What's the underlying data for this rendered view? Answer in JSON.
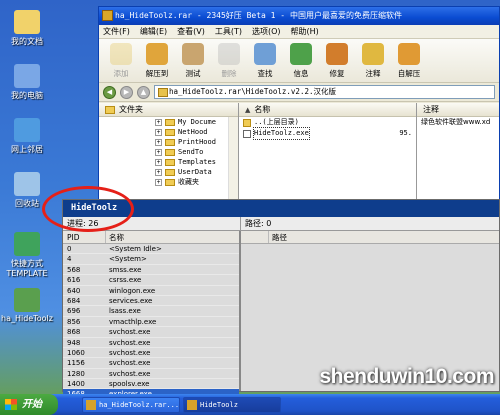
{
  "desktop": {
    "icons": [
      {
        "label": "我的文档",
        "color": "#f1d26a"
      },
      {
        "label": "我的电脑",
        "color": "#7aa7e6"
      },
      {
        "label": "网上邻居",
        "color": "#4f9be0"
      },
      {
        "label": "回收站",
        "color": "#9ec4e8"
      },
      {
        "label": "快捷方式 TEMPLATE",
        "color": "#3fa35c"
      },
      {
        "label": "ha_HideToolz",
        "color": "#5a9f4e"
      }
    ]
  },
  "winrar": {
    "title": "ha_HideToolz.rar - 2345好压 Beta 1 - 中国用户最喜爱的免费压缩软件",
    "menu": [
      "文件(F)",
      "编辑(E)",
      "查看(V)",
      "工具(T)",
      "选项(O)",
      "帮助(H)"
    ],
    "toolbar": [
      {
        "label": "添加",
        "icon": "add-icon",
        "color": "#e3c25a",
        "disabled": true
      },
      {
        "label": "解压到",
        "icon": "extract-icon",
        "color": "#e0a53b",
        "disabled": false
      },
      {
        "label": "测试",
        "icon": "test-icon",
        "color": "#c9a56f",
        "disabled": false
      },
      {
        "label": "删除",
        "icon": "delete-icon",
        "color": "#b0b0b0",
        "disabled": true
      },
      {
        "label": "查找",
        "icon": "find-icon",
        "color": "#6f9fd6",
        "disabled": false
      },
      {
        "label": "信息",
        "icon": "info-icon",
        "color": "#4ea14a",
        "disabled": false
      },
      {
        "label": "修复",
        "icon": "repair-icon",
        "color": "#d27d2c",
        "disabled": false
      },
      {
        "label": "注释",
        "icon": "comment-icon",
        "color": "#e0b840",
        "disabled": false
      },
      {
        "label": "自解压",
        "icon": "sfx-icon",
        "color": "#e09a34",
        "disabled": false
      }
    ],
    "address": "ha_HideToolz.rar\\HideToolz.v2.2.汉化版",
    "tree_header": "文件夹",
    "tree": [
      "My Docume",
      "NetHood",
      "PrintHood",
      "SendTo",
      "Templates",
      "UserData",
      "收藏夹"
    ],
    "list_header": "名称",
    "files": [
      {
        "name": "..(上层目录)",
        "size": ""
      },
      {
        "name": "HideToolz.exe",
        "size": "95."
      }
    ],
    "comment_header": "注释",
    "comment": "绿色软件联盟www.xd"
  },
  "dialog": {
    "title": "HideToolz",
    "process_label": "进程: 26",
    "path_label": "路径: 0",
    "col_pid": "PID",
    "col_name": "名称",
    "col_path": "路径",
    "processes": [
      {
        "pid": "0",
        "name": "<System Idle>"
      },
      {
        "pid": "4",
        "name": "<System>"
      },
      {
        "pid": "568",
        "name": "smss.exe"
      },
      {
        "pid": "616",
        "name": "csrss.exe"
      },
      {
        "pid": "640",
        "name": "winlogon.exe"
      },
      {
        "pid": "684",
        "name": "services.exe"
      },
      {
        "pid": "696",
        "name": "lsass.exe"
      },
      {
        "pid": "856",
        "name": "vmacthlp.exe"
      },
      {
        "pid": "868",
        "name": "svchost.exe"
      },
      {
        "pid": "948",
        "name": "svchost.exe"
      },
      {
        "pid": "1060",
        "name": "svchost.exe"
      },
      {
        "pid": "1156",
        "name": "svchost.exe"
      },
      {
        "pid": "1280",
        "name": "svchost.exe"
      },
      {
        "pid": "1400",
        "name": "spoolsv.exe"
      },
      {
        "pid": "1668",
        "name": "explorer.exe"
      }
    ]
  },
  "taskbar": {
    "start": "开始",
    "tasks": [
      "ha_HideToolz.rar...",
      "HideToolz"
    ]
  },
  "watermark": "shenduwin10.com"
}
